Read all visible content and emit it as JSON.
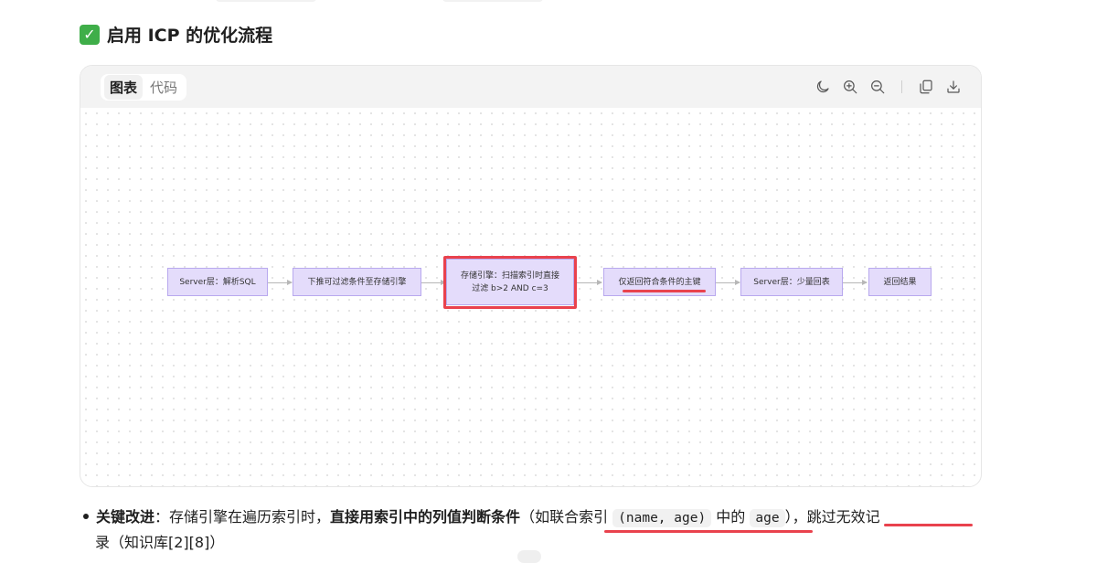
{
  "heading": {
    "emoji": "✅",
    "text": "启用 ICP 的优化流程"
  },
  "card": {
    "tabs": [
      {
        "label": "图表",
        "active": true
      },
      {
        "label": "代码",
        "active": false
      }
    ],
    "toolbar_icons": [
      "moon-icon",
      "zoom-in-icon",
      "zoom-out-icon",
      "copy-icon",
      "download-icon"
    ]
  },
  "flow": {
    "nodes": [
      {
        "label": "Server层：解析SQL"
      },
      {
        "label": "下推可过滤条件至存储引擎"
      },
      {
        "label": "存储引擎：扫描索引时直接过滤 b>2 AND c=3",
        "line1": "存储引擎：扫描索引时直接",
        "line2": "过滤 b>2 AND c=3"
      },
      {
        "label": "仅返回符合条件的主键"
      },
      {
        "label": "Server层：少量回表"
      },
      {
        "label": "返回结果"
      }
    ]
  },
  "bullet": {
    "key": "关键改进",
    "colon": "：",
    "text1": "存储引擎在遍历索引时，",
    "bold2": "直接用索引中的列值判断条件",
    "text3": "（如联合索引 ",
    "code1": "(name, age)",
    "text4": " 中的 ",
    "code2": "age",
    "text5": "），跳过无效记",
    "line2": "录（知识库[2][8]）"
  },
  "colors": {
    "node_fill": "#e4dcfb",
    "node_border": "#b8a8ee",
    "annotation_red": "#e9424d",
    "check_green": "#3fae49"
  }
}
